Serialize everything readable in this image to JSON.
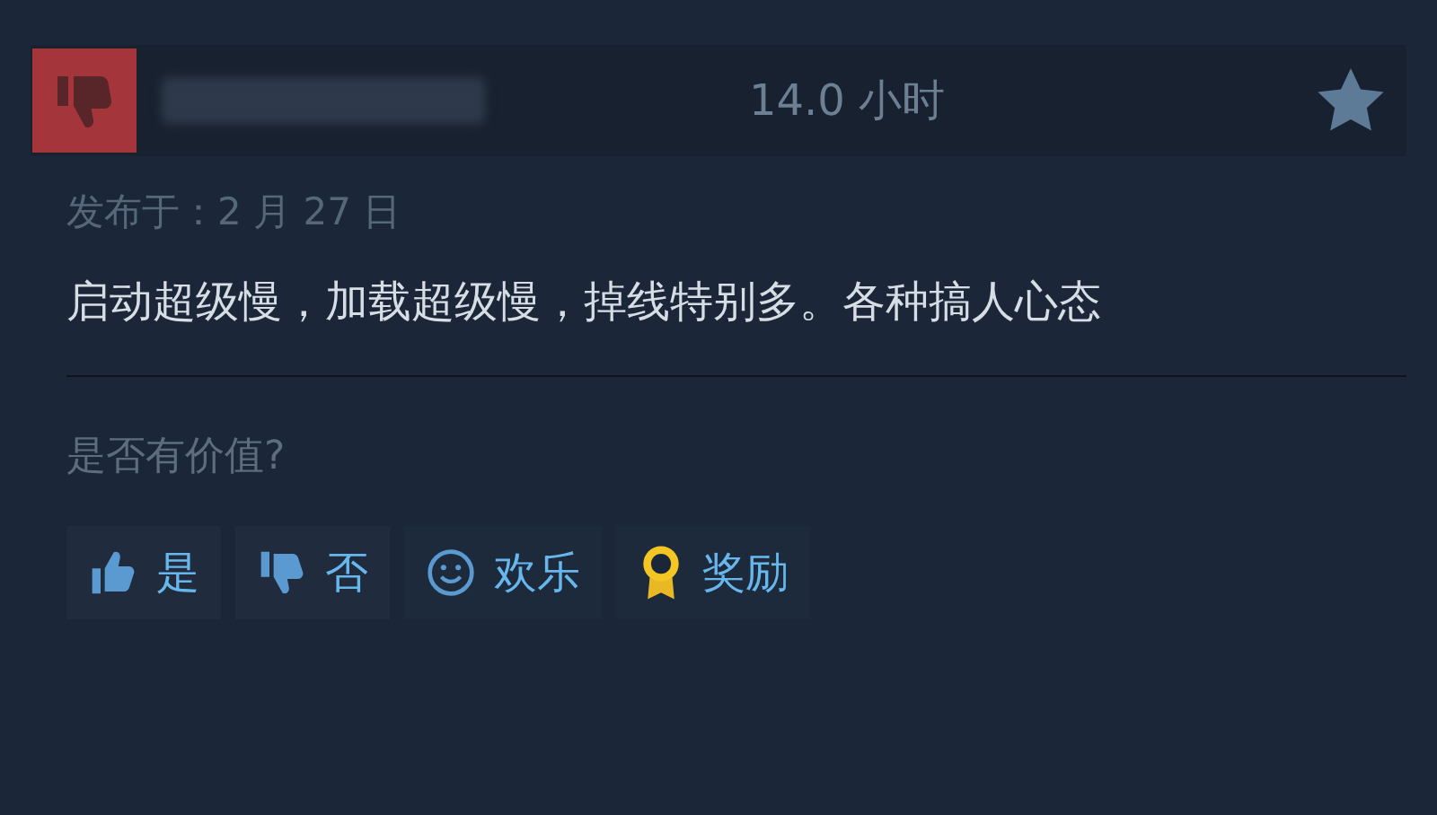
{
  "review": {
    "recommended": false,
    "hours": "14.0 小时",
    "posted": "发布于：2 月 27 日",
    "text": "启动超级慢，加载超级慢，掉线特别多。各种搞人心态"
  },
  "helpful_prompt": "是否有价值?",
  "buttons": [
    {
      "kind": "yes",
      "label": "是"
    },
    {
      "kind": "no",
      "label": "否"
    },
    {
      "kind": "funny",
      "label": "欢乐"
    },
    {
      "kind": "award",
      "label": "奖励"
    }
  ]
}
